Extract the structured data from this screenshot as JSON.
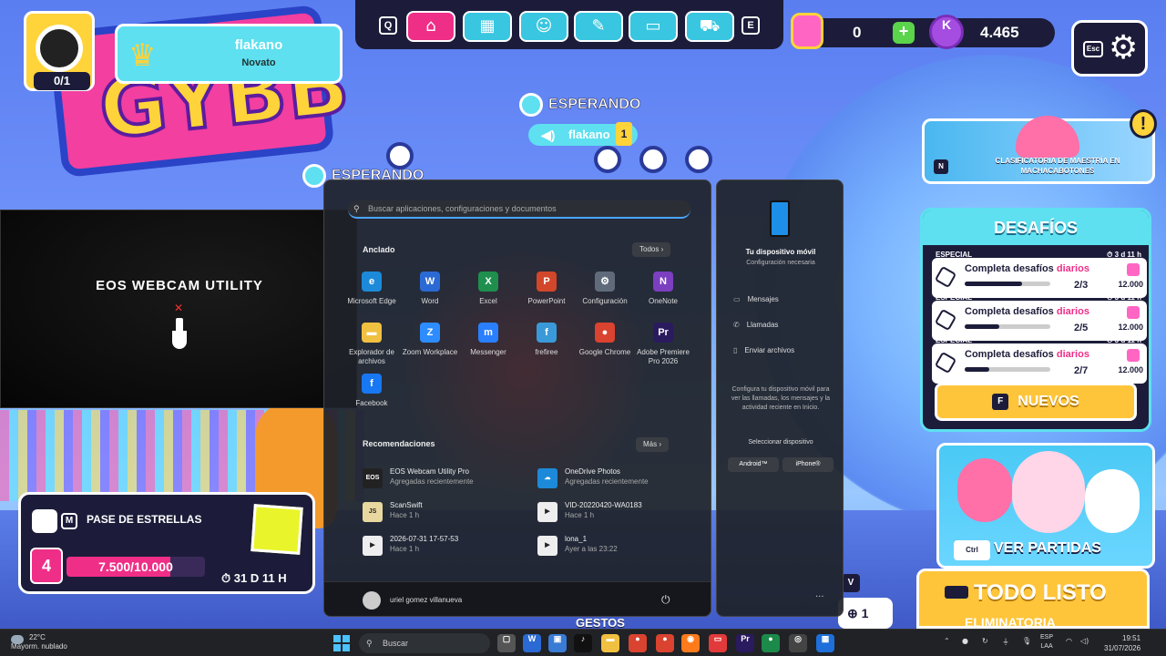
{
  "game": {
    "player": {
      "name": "flakano",
      "rank": "Novato",
      "crowns_progress": "0/1"
    },
    "hud_keys": {
      "left": "Q",
      "right": "E",
      "settings": "Esc"
    },
    "currency": {
      "gems": "0",
      "kudos": "4.465"
    },
    "status": "ESPERANDO",
    "status_secondary": "ESPERANDO",
    "voice": {
      "name": "flakano",
      "level": "1"
    },
    "promo": {
      "key": "N",
      "title": "CLASIFICATORIA DE MAESTRÍA EN MACHACABOTONES"
    },
    "challenges": {
      "title": "DESAFÍOS",
      "items": [
        {
          "tag": "ESPECIAL",
          "time": "3 d 11 h",
          "label": "Completa desafíos",
          "highlight": "diarios",
          "progress_text": "2/3",
          "progress": 0.67,
          "reward": "12.000"
        },
        {
          "tag": "ESPECIAL",
          "time": "3 d 11 h",
          "label": "Completa desafíos",
          "highlight": "diarios",
          "progress_text": "2/5",
          "progress": 0.4,
          "reward": "12.000"
        },
        {
          "tag": "ESPECIAL",
          "time": "3 d 11 h",
          "label": "Completa desafíos",
          "highlight": "diarios",
          "progress_text": "2/7",
          "progress": 0.29,
          "reward": "12.000"
        }
      ],
      "new_key": "F",
      "new_label": "NUEVOS"
    },
    "matches": {
      "key": "Ctrl",
      "label": "VER PARTIDAS"
    },
    "ready": {
      "title": "TODO LISTO",
      "subtitle": "ELIMINATORIA"
    },
    "v_key": "V",
    "plus_count": "1",
    "star_pass": {
      "key": "M",
      "title": "PASE DE ESTRELLAS",
      "level": "4",
      "progress_text": "7.500/10.000",
      "progress": 0.75,
      "timer": "31 D 11 H"
    },
    "gestures": "GESTOS"
  },
  "webcam": {
    "title": "EOS WEBCAM UTILITY"
  },
  "start_menu": {
    "search_placeholder": "Buscar aplicaciones, configuraciones y documentos",
    "pinned_title": "Anclado",
    "all_button": "Todos",
    "pinned": [
      {
        "name": "Microsoft Edge",
        "color": "#1c8ad9",
        "glyph": "e"
      },
      {
        "name": "Word",
        "color": "#2b6ad4",
        "glyph": "W"
      },
      {
        "name": "Excel",
        "color": "#1f8f4d",
        "glyph": "X"
      },
      {
        "name": "PowerPoint",
        "color": "#d2472a",
        "glyph": "P"
      },
      {
        "name": "Configuración",
        "color": "#5f6b7a",
        "glyph": "⚙"
      },
      {
        "name": "OneNote",
        "color": "#7b3fbf",
        "glyph": "N"
      },
      {
        "name": "Explorador de archivos",
        "color": "#f0c040",
        "glyph": "▬"
      },
      {
        "name": "Zoom Workplace",
        "color": "#2d8cff",
        "glyph": "Z"
      },
      {
        "name": "Messenger",
        "color": "#2a7fff",
        "glyph": "m"
      },
      {
        "name": "frefiree",
        "color": "#3a9ad9",
        "glyph": "f"
      },
      {
        "name": "Google Chrome",
        "color": "#d9432f",
        "glyph": "●"
      },
      {
        "name": "Adobe Premiere Pro 2026",
        "color": "#2a1a5e",
        "glyph": "Pr"
      },
      {
        "name": "Facebook",
        "color": "#1877f2",
        "glyph": "f"
      }
    ],
    "recommended_title": "Recomendaciones",
    "more_button": "Más",
    "recommended": [
      {
        "name": "EOS Webcam Utility Pro",
        "sub": "Agregadas recientemente",
        "color": "#222",
        "glyph": "EOS"
      },
      {
        "name": "OneDrive Photos",
        "sub": "Agregadas recientemente",
        "color": "#1c8ad9",
        "glyph": "☁"
      },
      {
        "name": "ScanSwift",
        "sub": "Hace 1 h",
        "color": "#e8d8a0",
        "glyph": "JS"
      },
      {
        "name": "VID-20220420-WA0183",
        "sub": "Hace 1 h",
        "color": "#eee",
        "glyph": "▶"
      },
      {
        "name": "2026-07-31 17-57-53",
        "sub": "Hace 1 h",
        "color": "#eee",
        "glyph": "▶"
      },
      {
        "name": "lona_1",
        "sub": "Ayer a las 23:22",
        "color": "#eee",
        "glyph": "▶"
      }
    ],
    "user": "uriel gomez villanueva"
  },
  "phone_link": {
    "title": "Tu dispositivo móvil",
    "subtitle": "Configuración necesaria",
    "items": [
      "Mensajes",
      "Llamadas",
      "Enviar archivos"
    ],
    "description": "Configura tu dispositivo móvil para ver las llamadas, los mensajes y la actividad reciente en Inicio.",
    "select": "Seleccionar dispositivo",
    "options": [
      "Android™",
      "iPhone®"
    ]
  },
  "taskbar": {
    "temp": "22°C",
    "weather": "Mayorm. nublado",
    "search": "Buscar",
    "lang": "ESP",
    "region": "LAA",
    "time": "19:51",
    "date": "31/07/2026"
  }
}
